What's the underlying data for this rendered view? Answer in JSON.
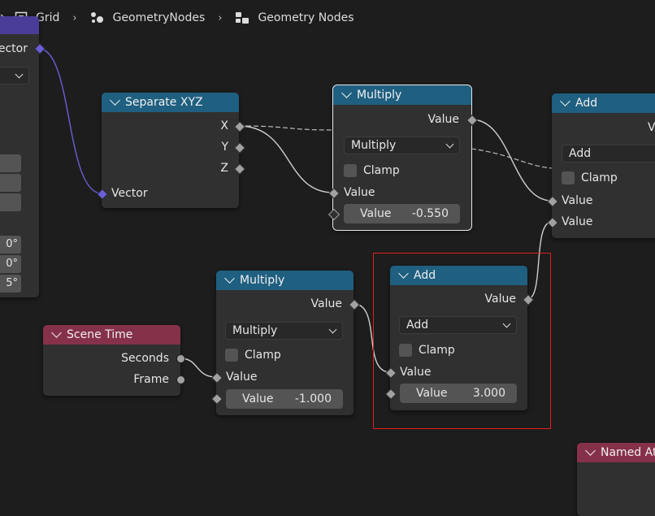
{
  "breadcrumb": {
    "items": [
      {
        "label": "Grid",
        "icon": "mesh-object-icon"
      },
      {
        "label": "GeometryNodes",
        "icon": "node-modifier-icon"
      },
      {
        "label": "Geometry Nodes",
        "icon": "node-tree-icon"
      }
    ]
  },
  "colors": {
    "background": "#1d1d1d",
    "node_body": "#303030",
    "utility_header": "#1f5f80",
    "input_header": "#86314a",
    "vector_header": "#4a3d9a",
    "vector_socket": "#6a5fd6",
    "float_socket": "#a1a1a1",
    "selection_box": "#e01e1e"
  },
  "left_partial_node": {
    "output_label": "ector",
    "values": [
      "0°",
      "0°",
      "5°"
    ]
  },
  "separate_xyz": {
    "title": "Separate XYZ",
    "outputs": [
      "X",
      "Y",
      "Z"
    ],
    "input": "Vector"
  },
  "multiply_top": {
    "title": "Multiply",
    "output": "Value",
    "operation": "Multiply",
    "clamp": "Clamp",
    "input": "Value",
    "field_label": "Value",
    "field_value": "-0.550"
  },
  "add_top": {
    "title": "Add",
    "output": "V",
    "operation": "Add",
    "clamp": "Clamp",
    "input1": "Value",
    "input2": "Value"
  },
  "scene_time": {
    "title": "Scene Time",
    "outputs": [
      "Seconds",
      "Frame"
    ]
  },
  "multiply_bottom": {
    "title": "Multiply",
    "output": "Value",
    "operation": "Multiply",
    "clamp": "Clamp",
    "input": "Value",
    "field_label": "Value",
    "field_value": "-1.000"
  },
  "add_bottom": {
    "title": "Add",
    "output": "Value",
    "operation": "Add",
    "clamp": "Clamp",
    "input": "Value",
    "field_label": "Value",
    "field_value": "3.000"
  },
  "named_attribute": {
    "title": "Named Att"
  }
}
